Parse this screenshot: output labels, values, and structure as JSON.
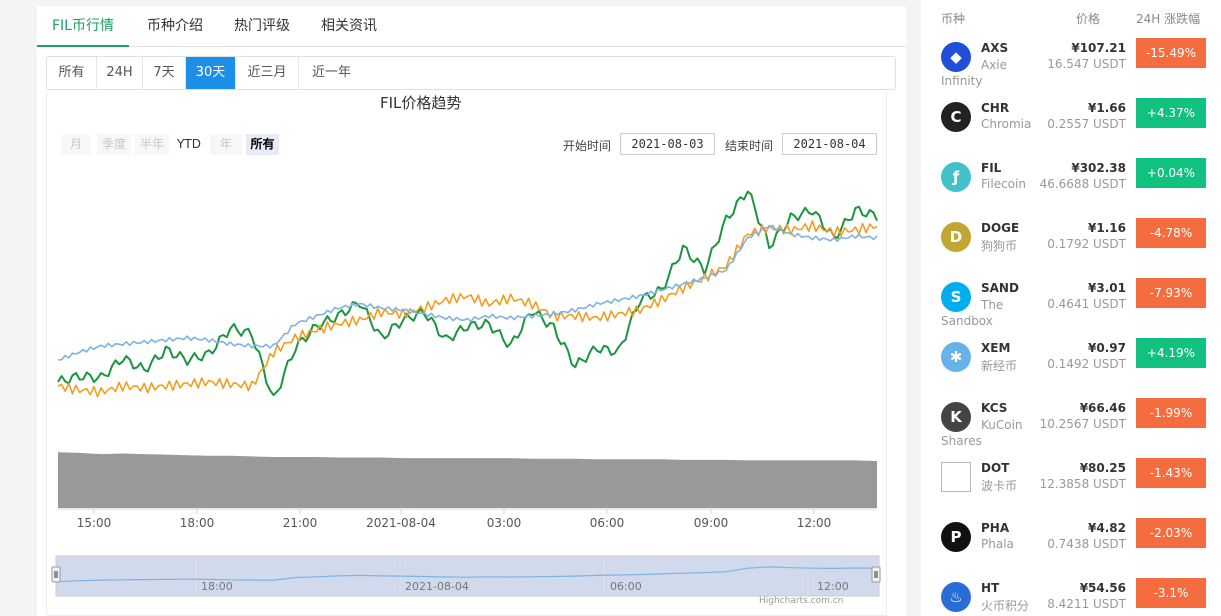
{
  "tabs": [
    {
      "label": "FIL币行情",
      "active": true
    },
    {
      "label": "币种介绍",
      "active": false
    },
    {
      "label": "热门评级",
      "active": false
    },
    {
      "label": "相关资讯",
      "active": false
    }
  ],
  "periods": [
    {
      "label": "所有",
      "active": false
    },
    {
      "label": "24H",
      "active": false
    },
    {
      "label": "7天",
      "active": false
    },
    {
      "label": "30天",
      "active": true
    },
    {
      "label": "近三月",
      "active": false
    },
    {
      "label": "近一年",
      "active": false
    }
  ],
  "chart": {
    "title": "FIL价格趋势",
    "zoom_buttons": [
      {
        "label": "月",
        "state": "disabled"
      },
      {
        "label": "季度",
        "state": "disabled"
      },
      {
        "label": "半年",
        "state": "disabled"
      },
      {
        "label": "YTD",
        "state": "enabled"
      },
      {
        "label": "年",
        "state": "disabled"
      },
      {
        "label": "所有",
        "state": "selected"
      }
    ],
    "start_label": "开始时间",
    "start_value": "2021-08-03",
    "end_label": "结束时间",
    "end_value": "2021-08-04",
    "credit": "Highcharts.com.cn"
  },
  "chart_data": {
    "type": "line",
    "title": "FIL价格趋势",
    "x_tick_labels": [
      "15:00",
      "18:00",
      "21:00",
      "2021-08-04",
      "03:00",
      "06:00",
      "09:00",
      "12:00"
    ],
    "navigator_labels": [
      "18:00",
      "2021-08-04",
      "06:00",
      "12:00"
    ],
    "x_range": [
      "2021-08-03 13:40",
      "2021-08-04 13:55"
    ],
    "series": [
      {
        "color": "#1a9641",
        "relative_level": [
          0.18,
          0.24,
          0.22,
          0.42,
          0.3,
          0.5,
          0.4,
          0.46,
          0.72,
          0.66,
          0.0,
          0.52,
          0.74,
          0.84,
          0.98,
          0.62,
          0.8,
          0.88,
          0.6,
          0.74,
          0.76,
          0.54,
          0.9,
          0.72,
          0.34,
          0.52,
          0.48,
          1.0,
          1.1,
          1.52,
          1.3,
          1.8,
          2.1,
          1.54,
          1.82,
          1.9,
          1.62,
          1.9,
          1.84
        ]
      },
      {
        "color": "#f39c1f",
        "relative_level": [
          0.14,
          0.1,
          0.08,
          0.14,
          0.12,
          0.14,
          0.16,
          0.18,
          0.16,
          0.14,
          0.48,
          0.62,
          0.7,
          0.76,
          0.8,
          0.88,
          0.86,
          0.92,
          1.0,
          1.04,
          0.96,
          1.02,
          0.96,
          0.84,
          0.84,
          0.82,
          0.86,
          0.9,
          1.0,
          1.12,
          1.22,
          1.34,
          1.66,
          1.72,
          1.7,
          1.74,
          1.68,
          1.7,
          1.74
        ]
      },
      {
        "color": "#7fb2e5",
        "relative_level": [
          0.4,
          0.48,
          0.54,
          0.56,
          0.58,
          0.6,
          0.62,
          0.6,
          0.56,
          0.54,
          0.54,
          0.76,
          0.84,
          0.92,
          0.96,
          0.92,
          0.9,
          0.86,
          0.82,
          0.8,
          0.84,
          0.82,
          0.84,
          0.86,
          0.9,
          0.96,
          1.0,
          1.04,
          1.1,
          1.16,
          1.22,
          1.3,
          1.62,
          1.74,
          1.66,
          1.62,
          1.6,
          1.64,
          1.62
        ]
      }
    ],
    "volume_area": {
      "color": "#999999",
      "relative_level": [
        0.96,
        0.95,
        0.93,
        0.94,
        0.93,
        0.92,
        0.91,
        0.9,
        0.9,
        0.89,
        0.88,
        0.88,
        0.88,
        0.87,
        0.87,
        0.87,
        0.86,
        0.86,
        0.86,
        0.86,
        0.86,
        0.86,
        0.85,
        0.85,
        0.85,
        0.84,
        0.84,
        0.84,
        0.84,
        0.83,
        0.83,
        0.83,
        0.82,
        0.82,
        0.82,
        0.82,
        0.82,
        0.82,
        0.81
      ]
    }
  },
  "sidebar": {
    "headers": {
      "coin": "币种",
      "price": "价格",
      "change": "24H 涨跌幅"
    },
    "coins": [
      {
        "symbol": "AXS",
        "name": "Axie Infinity",
        "price": "¥107.21",
        "usdt": "16.547 USDT",
        "change": "-15.49%",
        "dir": "down",
        "icon": "axs-icon",
        "icon_color": "#1f4fd8"
      },
      {
        "symbol": "CHR",
        "name": "Chromia",
        "price": "¥1.66",
        "usdt": "0.2557 USDT",
        "change": "+4.37%",
        "dir": "up",
        "icon": "chr-icon",
        "icon_color": "#222222"
      },
      {
        "symbol": "FIL",
        "name": "Filecoin",
        "price": "¥302.38",
        "usdt": "46.6688 USDT",
        "change": "+0.04%",
        "dir": "up",
        "icon": "fil-icon",
        "icon_color": "#42c1ca"
      },
      {
        "symbol": "DOGE",
        "name": "狗狗币",
        "price": "¥1.16",
        "usdt": "0.1792 USDT",
        "change": "-4.78%",
        "dir": "down",
        "icon": "doge-icon",
        "icon_color": "#c2a633"
      },
      {
        "symbol": "SAND",
        "name": "The Sandbox",
        "price": "¥3.01",
        "usdt": "0.4641 USDT",
        "change": "-7.93%",
        "dir": "down",
        "icon": "sand-icon",
        "icon_color": "#00adef"
      },
      {
        "symbol": "XEM",
        "name": "新经币",
        "price": "¥0.97",
        "usdt": "0.1492 USDT",
        "change": "+4.19%",
        "dir": "up",
        "icon": "xem-icon",
        "icon_color": "#67b2e8"
      },
      {
        "symbol": "KCS",
        "name": "KuCoin Shares",
        "price": "¥66.46",
        "usdt": "10.2567 USDT",
        "change": "-1.99%",
        "dir": "down",
        "icon": "kcs-icon",
        "icon_color": "#444444"
      },
      {
        "symbol": "DOT",
        "name": "波卡币",
        "price": "¥80.25",
        "usdt": "12.3858 USDT",
        "change": "-1.43%",
        "dir": "down",
        "icon": "dot-broken-image-icon",
        "icon_color": "#cccccc"
      },
      {
        "symbol": "PHA",
        "name": "Phala",
        "price": "¥4.82",
        "usdt": "0.7438 USDT",
        "change": "-2.03%",
        "dir": "down",
        "icon": "pha-icon",
        "icon_color": "#111111"
      },
      {
        "symbol": "HT",
        "name": "火币积分",
        "price": "¥54.56",
        "usdt": "8.4211 USDT",
        "change": "-3.1%",
        "dir": "down",
        "icon": "ht-icon",
        "icon_color": "#2a6cd6"
      }
    ]
  }
}
